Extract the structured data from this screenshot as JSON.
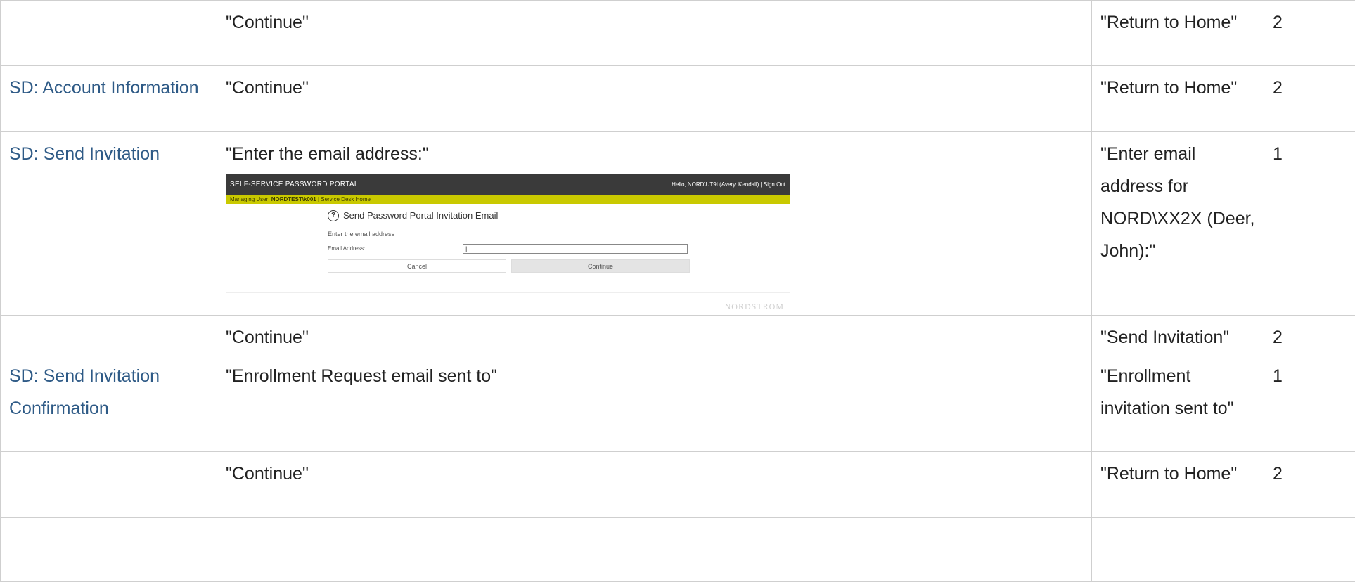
{
  "rows": [
    {
      "step": "",
      "prompt": "\"Continue\"",
      "response": "\"Return to Home\"",
      "level": "2"
    },
    {
      "step": "SD: Account Information",
      "prompt": "\"Continue\"",
      "response": "\"Return to Home\"",
      "level": "2"
    },
    {
      "step": "SD: Send Invitation",
      "prompt": "\"Enter the email address:\"",
      "response": "\"Enter email address for NORD\\XX2X (Deer, John):\"",
      "level": "1"
    },
    {
      "step": "",
      "prompt": "\"Continue\"",
      "response": "\"Send Invitation\"",
      "level": "2"
    },
    {
      "step": "SD: Send Invitation Confirmation",
      "prompt": "\"Enrollment Request email sent to\"",
      "response": "\"Enrollment invitation sent to\"",
      "level": "1"
    },
    {
      "step": "",
      "prompt": "\"Continue\"",
      "response": "\"Return to Home\"",
      "level": "2"
    },
    {
      "step": "",
      "prompt": "",
      "response": "",
      "level": ""
    }
  ],
  "portal": {
    "title": "SELF-SERVICE PASSWORD PORTAL",
    "user": "Hello, NORD\\UT9I (Avery, Kendall) | Sign Out",
    "bar_label": "Managing User:",
    "bar_user": "NORDTEST\\k001",
    "bar_link": "| Service Desk Home",
    "dialog_title": "Send Password Portal Invitation Email",
    "help_icon": "question-circle-icon",
    "prompt": "Enter the email address",
    "email_label": "Email Address:",
    "email_value": "|",
    "cancel_label": "Cancel",
    "continue_label": "Continue",
    "logo": "NORDSTROM"
  },
  "colors": {
    "step_link": "#2e5a86",
    "portal_header": "#3a3a3a",
    "portal_bar": "#c9c900",
    "border": "#cfcfcf"
  }
}
